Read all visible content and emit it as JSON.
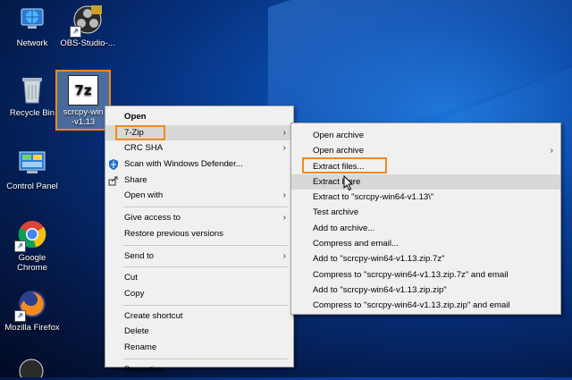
{
  "desktop": {
    "icons": [
      {
        "label": "Network",
        "icon": "network-icon"
      },
      {
        "label": "OBS-Studio-...",
        "icon": "obs-icon"
      },
      {
        "label": "Recycle Bin",
        "icon": "recycle-bin-icon"
      },
      {
        "label": "Control Panel",
        "icon": "control-panel-icon"
      },
      {
        "label": "Google Chrome",
        "icon": "chrome-icon"
      },
      {
        "label": "Mozilla Firefox",
        "icon": "firefox-icon"
      }
    ],
    "selected_file": {
      "label": "scrcpy-win64-v1.13",
      "label_line1": "scrcpy-win",
      "label_line2": "-v1.13",
      "icon_text": "7z"
    }
  },
  "context_menu": {
    "open": "Open",
    "seven_zip": "7-Zip",
    "crc_sha": "CRC SHA",
    "scan_defender": "Scan with Windows Defender...",
    "share": "Share",
    "open_with": "Open with",
    "give_access": "Give access to",
    "restore_versions": "Restore previous versions",
    "send_to": "Send to",
    "cut": "Cut",
    "copy": "Copy",
    "create_shortcut": "Create shortcut",
    "delete": "Delete",
    "rename": "Rename",
    "properties": "Properties"
  },
  "submenu_7zip": {
    "open_archive": "Open archive",
    "open_archive_2": "Open archive",
    "extract_files": "Extract files...",
    "extract_here": "Extract Here",
    "extract_to": "Extract to \"scrcpy-win64-v1.13\\\"",
    "test_archive": "Test archive",
    "add_to_archive": "Add to archive...",
    "compress_email": "Compress and email...",
    "add_7z": "Add to \"scrcpy-win64-v1.13.zip.7z\"",
    "compress_7z_email": "Compress to \"scrcpy-win64-v1.13.zip.7z\" and email",
    "add_zip": "Add to \"scrcpy-win64-v1.13.zip.zip\"",
    "compress_zip_email": "Compress to \"scrcpy-win64-v1.13.zip.zip\" and email"
  },
  "colors": {
    "highlight_box": "#f08a1c",
    "menu_bg": "#f0f0f0",
    "hover": "#d8d8d8"
  }
}
